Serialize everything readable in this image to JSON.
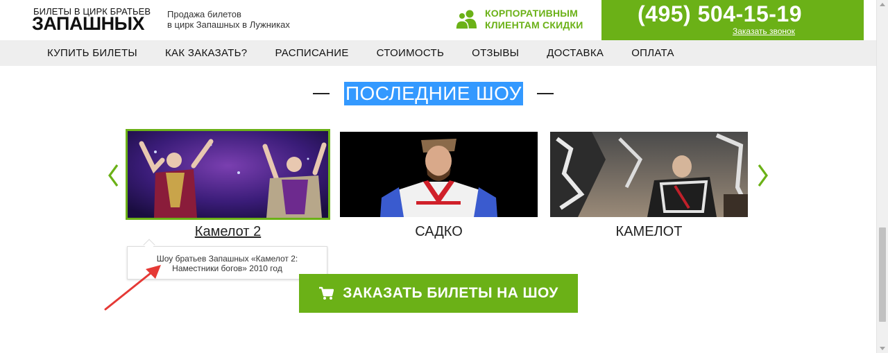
{
  "header": {
    "logo_top": "БИЛЕТЫ В ЦИРК БРАТЬЕВ",
    "logo_main": "ЗАПАШНЫХ",
    "tagline_line1": "Продажа билетов",
    "tagline_line2": "в цирк Запашных в Лужниках",
    "corporate_line1": "КОРПОРАТИВНЫМ",
    "corporate_line2": "КЛИЕНТАМ СКИДКИ",
    "phone": "(495) 504-15-19",
    "callback_link": "Заказать звонок"
  },
  "nav": {
    "items": [
      {
        "label": "КУПИТЬ БИЛЕТЫ"
      },
      {
        "label": "КАК ЗАКАЗАТЬ?"
      },
      {
        "label": "РАСПИСАНИЕ"
      },
      {
        "label": "СТОИМОСТЬ"
      },
      {
        "label": "ОТЗЫВЫ"
      },
      {
        "label": "ДОСТАВКА"
      },
      {
        "label": "ОПЛАТА"
      }
    ]
  },
  "section": {
    "title": "ПОСЛЕДНИЕ ШОУ"
  },
  "carousel": {
    "prev_icon": "chevron-left-icon",
    "next_icon": "chevron-right-icon",
    "shows": [
      {
        "title": "Камелот 2",
        "selected": true
      },
      {
        "title": "САДКО",
        "selected": false
      },
      {
        "title": "КАМЕЛОТ",
        "selected": false
      }
    ]
  },
  "tooltip": {
    "line1": "Шоу братьев Запашных «Камелот 2:",
    "line2": "Наместники богов» 2010 год"
  },
  "order_button": {
    "label": "ЗАКАЗАТЬ БИЛЕТЫ НА ШОУ",
    "icon": "cart-icon"
  },
  "colors": {
    "brand_green": "#6bb117",
    "selection_blue": "#3399ff",
    "nav_bg": "#eeeeee",
    "annotation_arrow": "#e53935"
  }
}
